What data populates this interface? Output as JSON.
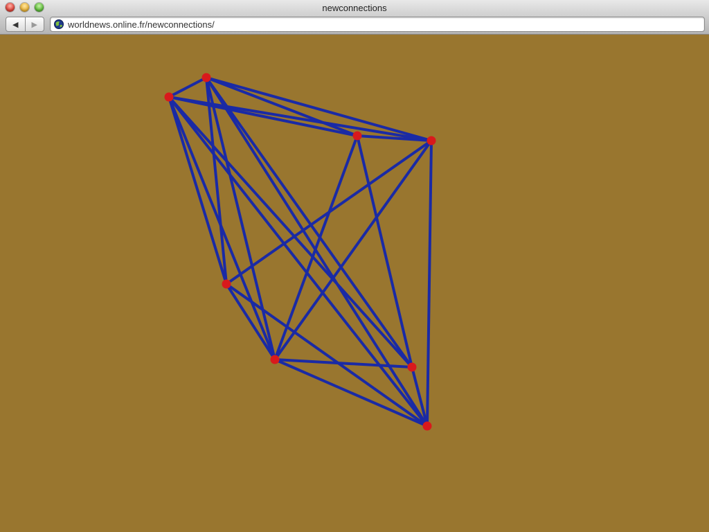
{
  "window": {
    "title": "newconnections"
  },
  "toolbar": {
    "back_icon": "back-arrow-icon",
    "forward_icon": "forward-arrow-icon",
    "url": "worldnews.online.fr/newconnections/",
    "site_icon": "globe-icon"
  },
  "colors": {
    "background": "#99762f",
    "edge": "#1a2aa5",
    "node": "#d9191c"
  },
  "graph": {
    "nodes": [
      {
        "id": "n1"
      },
      {
        "id": "n2"
      },
      {
        "id": "n3"
      },
      {
        "id": "n4"
      },
      {
        "id": "n5"
      },
      {
        "id": "n6"
      },
      {
        "id": "n7"
      },
      {
        "id": "n8"
      }
    ],
    "edges": [
      [
        "n1",
        "n2"
      ],
      [
        "n1",
        "n3"
      ],
      [
        "n1",
        "n4"
      ],
      [
        "n1",
        "n5"
      ],
      [
        "n1",
        "n6"
      ],
      [
        "n1",
        "n7"
      ],
      [
        "n1",
        "n8"
      ],
      [
        "n2",
        "n3"
      ],
      [
        "n2",
        "n4"
      ],
      [
        "n2",
        "n5"
      ],
      [
        "n2",
        "n6"
      ],
      [
        "n2",
        "n7"
      ],
      [
        "n2",
        "n8"
      ],
      [
        "n3",
        "n4"
      ],
      [
        "n3",
        "n6"
      ],
      [
        "n3",
        "n7"
      ],
      [
        "n4",
        "n5"
      ],
      [
        "n4",
        "n6"
      ],
      [
        "n4",
        "n8"
      ],
      [
        "n5",
        "n6"
      ],
      [
        "n5",
        "n8"
      ],
      [
        "n6",
        "n7"
      ],
      [
        "n6",
        "n8"
      ],
      [
        "n7",
        "n8"
      ]
    ]
  }
}
